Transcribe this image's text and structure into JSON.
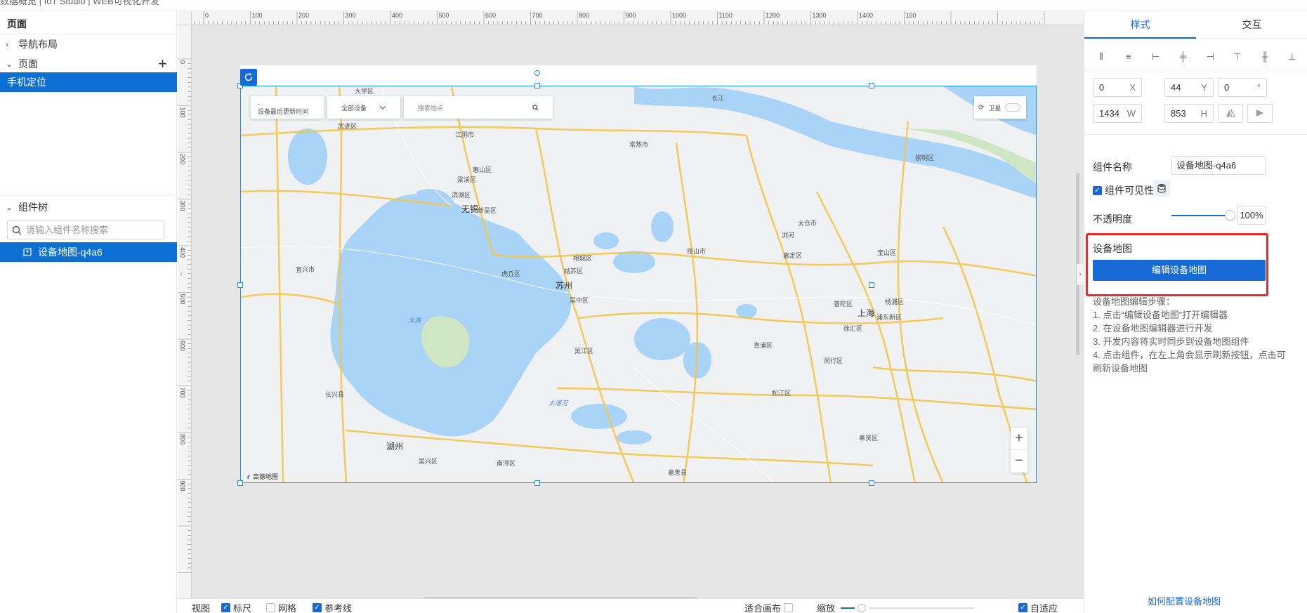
{
  "app": {
    "title_fragment": "数据概览 | IoT Studio | WEB可视化开发"
  },
  "left": {
    "page_section_title": "页面",
    "nav_layout_label": "导航布局",
    "pages_label": "页面",
    "selected_page": "手机定位",
    "tree_label": "组件树",
    "search_placeholder": "请输入组件名称搜索",
    "tree_item": "设备地图-q4a6"
  },
  "ruler": {
    "h_ticks": [
      "00",
      "0",
      "100",
      "200",
      "300",
      "400",
      "500",
      "600",
      "700",
      "800",
      "900",
      "1000",
      "1100",
      "1200",
      "1300",
      "1400",
      "150"
    ],
    "v_ticks": [
      "0",
      "100",
      "200",
      "300",
      "400",
      "500",
      "600",
      "700",
      "800",
      "900"
    ]
  },
  "map": {
    "ctrl_line1": "-",
    "ctrl_line2": "设备最后更新时间",
    "device_select": "全部设备",
    "search_placeholder": "搜索地点",
    "satellite_label": "卫星",
    "zoom_in": "+",
    "zoom_out": "−",
    "logo_text": "高德地图",
    "labels": {
      "suzhou": "苏州",
      "wuxi": "无锡",
      "shanghai": "上海",
      "taihu": "太湖",
      "huzhou": "湖州",
      "changjiang": "长江",
      "kunshan": "昆山市",
      "taicang": "太仓市",
      "changshu": "常熟市",
      "jiangyin": "江阴市",
      "yixing": "宜兴市",
      "wujiang": "吴江区",
      "wuzhong": "吴中区",
      "gusu": "姑苏区",
      "xiangcheng": "相城区",
      "huqiu": "虎丘区",
      "qingpu": "青浦区",
      "songjiang": "松江区",
      "jiading": "嘉定区",
      "minhang": "闵行区",
      "xuhui": "徐汇区",
      "yangpu": "杨浦区",
      "pudong": "浦东新区",
      "baoshan": "宝山区",
      "chongming": "崇明区",
      "fengxian": "奉贤区",
      "jiashan": "嘉善县",
      "nanxun": "南浔区",
      "changxing": "长兴县",
      "wuxing": "吴兴区",
      "liangxi": "梁溪区",
      "xinwu": "新吴区",
      "binhu": "滨湖区",
      "huishan": "惠山区",
      "wujin": "武进区",
      "putuo": "普陀区",
      "taipuhe": "太浦河",
      "liuhe": "浏河"
    }
  },
  "bottom": {
    "view_label": "视图",
    "ruler_label": "标尺",
    "grid_label": "网格",
    "guides_label": "参考线",
    "fit_label": "适合画布",
    "zoom_label": "缩放",
    "auto_label": "自适应"
  },
  "right": {
    "tab_style": "样式",
    "tab_interact": "交互",
    "x_value": "0",
    "x_unit": "X",
    "y_value": "44",
    "y_unit": "Y",
    "rot_value": "0",
    "rot_unit": "°",
    "w_value": "1434",
    "w_unit": "W",
    "h_value": "853",
    "h_unit": "H",
    "name_label": "组件名称",
    "name_value": "设备地图-q4a6",
    "visible_label": "组件可见性",
    "opacity_label": "不透明度",
    "opacity_value": "100%",
    "opacity": 1.0,
    "map_section": "设备地图",
    "edit_button": "编辑设备地图",
    "steps_title": "设备地图编辑步骤：",
    "step1": "1. 点击“编辑设备地图”打开编辑器",
    "step2": "2. 在设备地图编辑器进行开发",
    "step3": "3. 开发内容将实时同步到设备地图组件",
    "step4a": "4. 点击组件，在左上角会显示刷新按钮，点击可",
    "step4b": "刷新设备地图",
    "help_link": "如何配置设备地图"
  },
  "colors": {
    "accent": "#1769d6",
    "highlight": "#e62b2b",
    "water": "#a9d3f7",
    "road": "#f5c54a"
  }
}
